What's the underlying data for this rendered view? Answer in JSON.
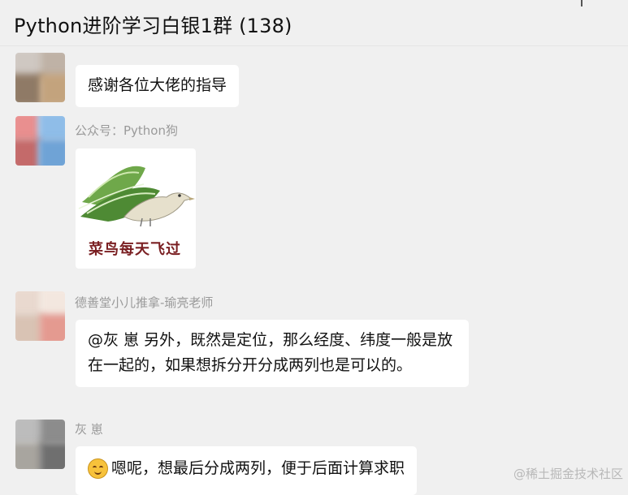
{
  "header": {
    "title": "Python进阶学习白银1群 (138)"
  },
  "messages": [
    {
      "sender": "",
      "text": "感谢各位大佬的指导"
    },
    {
      "sender": "公众号：Python狗",
      "sticker_caption": "菜鸟每天飞过"
    },
    {
      "sender": "德善堂小儿推拿-瑜亮老师",
      "text": "@灰 崽 另外，既然是定位，那么经度、纬度一般是放在一起的，如果想拆分开分成两列也是可以的。"
    },
    {
      "sender": "灰 崽",
      "emoji": "smile-emoji",
      "text": "嗯呢，想最后分成两列，便于后面计算求职"
    }
  ],
  "watermark": "@稀土掘金技术社区",
  "colors": {
    "background": "#f0f0f0",
    "bubble": "#ffffff",
    "sender_text": "#9a9a9a",
    "sticker_caption": "#7a1f22"
  }
}
